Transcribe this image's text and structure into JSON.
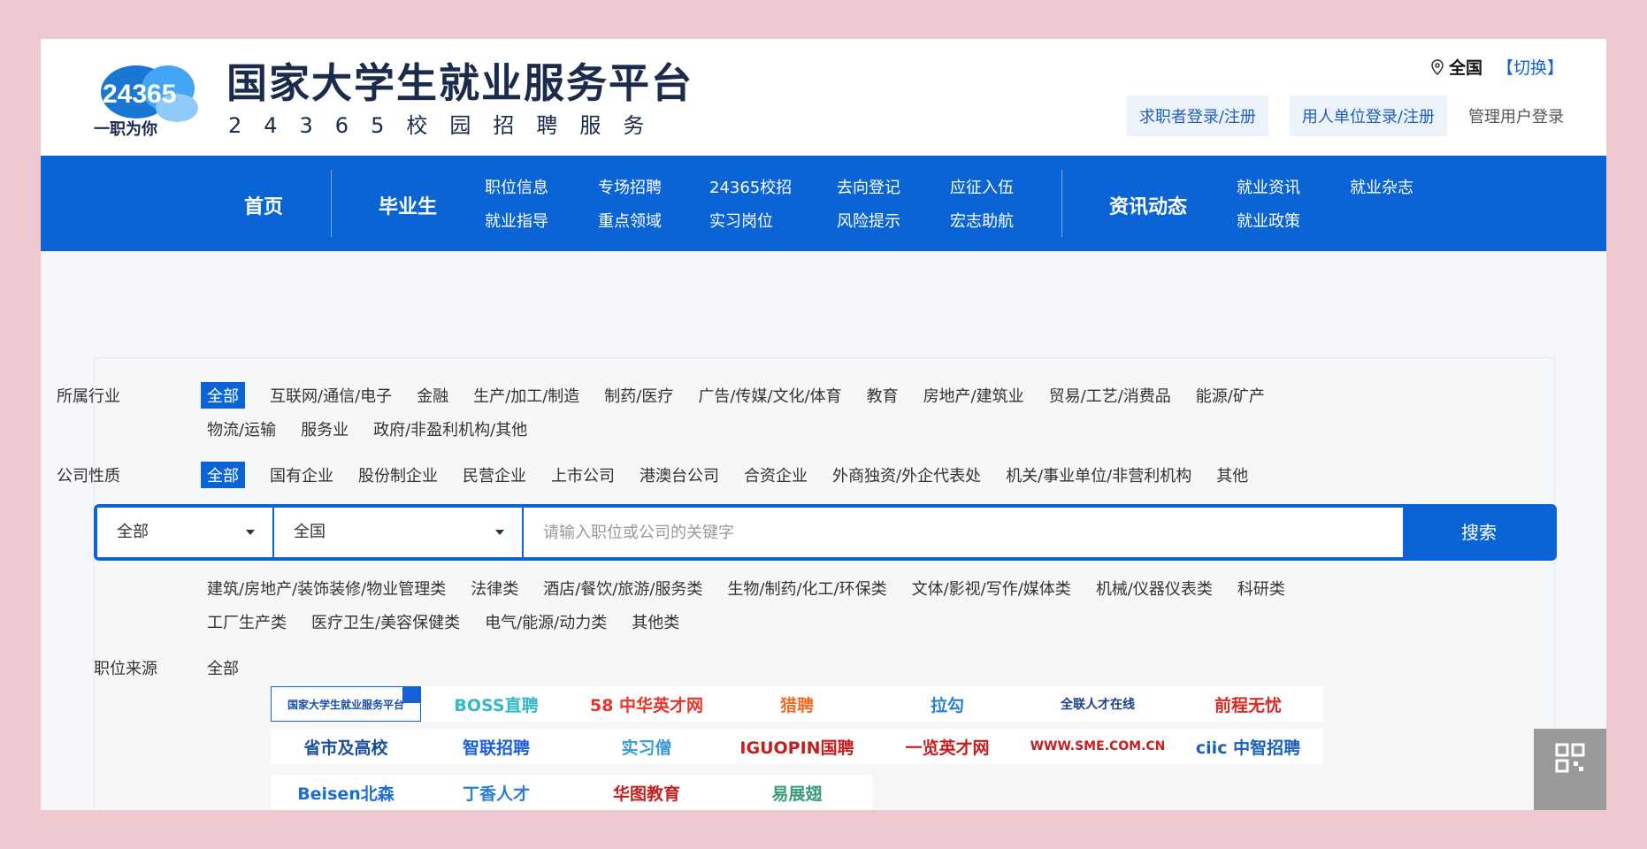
{
  "header": {
    "logo_number": "24365",
    "logo_slogan": "一职为你",
    "title": "国家大学生就业服务平台",
    "subtitle": "24365校园招聘服务",
    "region_name": "全国",
    "region_switch": "【切换】",
    "login_seeker": "求职者登录/注册",
    "login_employer": "用人单位登录/注册",
    "login_admin": "管理用户登录"
  },
  "nav": {
    "home": "首页",
    "graduates": "毕业生",
    "links_row1": [
      "职位信息",
      "专场招聘",
      "24365校招",
      "去向登记",
      "应征入伍"
    ],
    "links_row2": [
      "就业指导",
      "重点领域",
      "实习岗位",
      "风险提示",
      "宏志助航"
    ],
    "news": "资讯动态",
    "news_row1": [
      "就业资讯",
      "就业杂志"
    ],
    "news_row2": [
      "就业政策"
    ]
  },
  "filters": {
    "industry_label": "所属行业",
    "industry_row1": [
      "全部",
      "互联网/通信/电子",
      "金融",
      "生产/加工/制造",
      "制药/医疗",
      "广告/传媒/文化/体育",
      "教育",
      "房地产/建筑业",
      "贸易/工艺/消费品",
      "能源/矿产"
    ],
    "industry_row2": [
      "物流/运输",
      "服务业",
      "政府/非盈利机构/其他"
    ],
    "company_label": "公司性质",
    "company_types": [
      "全部",
      "国有企业",
      "股份制企业",
      "民营企业",
      "上市公司",
      "港澳台公司",
      "合资企业",
      "外商独资/外企代表处",
      "机关/事业单位/非营利机构",
      "其他"
    ],
    "category_row1": [
      "建筑/房地产/装饰装修/物业管理类",
      "法律类",
      "酒店/餐饮/旅游/服务类",
      "生物/制药/化工/环保类",
      "文体/影视/写作/媒体类",
      "机械/仪器仪表类",
      "科研类"
    ],
    "category_row2": [
      "工厂生产类",
      "医疗卫生/美容保健类",
      "电气/能源/动力类",
      "其他类"
    ]
  },
  "search": {
    "category_value": "全部",
    "region_value": "全国",
    "placeholder": "请输入职位或公司的关键字",
    "button": "搜索"
  },
  "sources": {
    "label": "职位来源",
    "all": "全部",
    "items": [
      {
        "text": "国家大学生就业服务平台",
        "color": "#1a4fa0"
      },
      {
        "text": "BOSS直聘",
        "color": "#32b8c6"
      },
      {
        "text": "58 中华英才网",
        "color": "#e8342a"
      },
      {
        "text": "猎聘",
        "color": "#f06a2a"
      },
      {
        "text": "拉勾",
        "color": "#2a7fd6"
      },
      {
        "text": "全联人才在线",
        "color": "#1a3f8c"
      },
      {
        "text": "前程无忧",
        "color": "#d92b26"
      },
      {
        "text": "省市及高校",
        "color": "#1a4fa0"
      },
      {
        "text": "智联招聘",
        "color": "#1a5fd6"
      },
      {
        "text": "实习僧",
        "color": "#3a9ad6"
      },
      {
        "text": "IGUOPIN国聘",
        "color": "#c41f1f"
      },
      {
        "text": "一览英才网",
        "color": "#c41f1f"
      },
      {
        "text": "WWW.SME.COM.CN",
        "color": "#c41f1f"
      },
      {
        "text": "ciic 中智招聘",
        "color": "#1a5fb8"
      },
      {
        "text": "Beisen北森",
        "color": "#1a6fd6"
      },
      {
        "text": "丁香人才",
        "color": "#2a7fd6"
      },
      {
        "text": "华图教育",
        "color": "#c41f1f"
      },
      {
        "text": "易展翅",
        "color": "#3a9a7a"
      }
    ]
  }
}
